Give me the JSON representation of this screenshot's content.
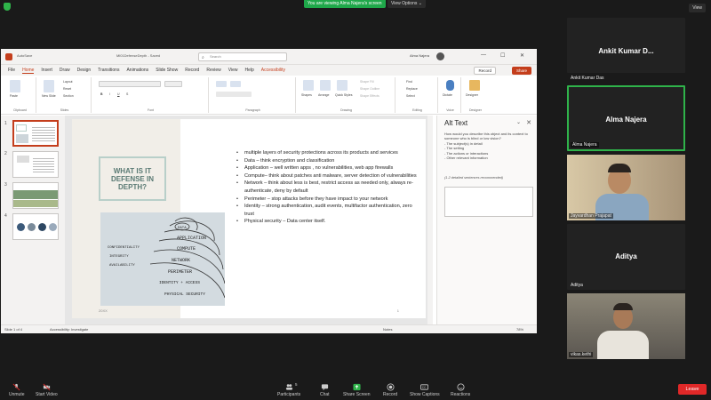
{
  "zoom": {
    "share_banner": "You are viewing Alma Najera's screen",
    "view_options": "View Options ⌄",
    "view_button": "View",
    "participants": [
      {
        "name": "Ankit Kumar D...",
        "label": "Ankit Kumar Das",
        "video": false
      },
      {
        "name": "Alma Najera",
        "label": "Alma Najera",
        "video": false,
        "active": true
      },
      {
        "label": "Jayvardhan Prajapat",
        "video": true
      },
      {
        "name": "Aditya",
        "label": "Aditya",
        "video": false
      },
      {
        "label": "vikas.kethi",
        "video": true
      }
    ],
    "toolbar": {
      "unmute": "Unmute",
      "start_video": "Start Video",
      "participants": "Participants",
      "participants_count": "5",
      "chat": "Chat",
      "share_screen": "Share Screen",
      "record": "Record",
      "show_captions": "Show Captions",
      "reactions": "Reactions",
      "leave": "Leave"
    }
  },
  "ppt": {
    "autosave": "AutoSave",
    "filename": "Ml01DefenseDepth - Saved",
    "search": "Search",
    "user": "Alma Najera",
    "menu": [
      "File",
      "Home",
      "Insert",
      "Draw",
      "Design",
      "Transitions",
      "Animations",
      "Slide Show",
      "Record",
      "Review",
      "View",
      "Help",
      "Accessibility"
    ],
    "active_tab": "Home",
    "record_btn": "Record",
    "share_btn": "Share",
    "ribbon_groups": [
      "Clipboard",
      "Slides",
      "Font",
      "Paragraph",
      "Drawing",
      "Editing",
      "Voice",
      "Designer"
    ],
    "ribbon_labels": {
      "paste": "Paste",
      "new_slide": "New Slide",
      "layout": "Layout",
      "reset": "Reset",
      "section": "Section",
      "shapes": "Shapes",
      "arrange": "Arrange",
      "quick_styles": "Quick Styles",
      "shape_fill": "Shape Fill",
      "shape_outline": "Shape Outline",
      "shape_effects": "Shape Effects",
      "find": "Find",
      "replace": "Replace",
      "select": "Select",
      "dictate": "Dictate",
      "designer": "Designer"
    },
    "thumb_numbers": [
      "1",
      "2",
      "3",
      "4"
    ],
    "slide": {
      "title": "WHAT IS IT DEFENSE IN DEPTH?",
      "bullets": [
        "multiple layers of security protections across its products and services",
        "Data – think encryption and classification",
        "Application – well written apps , no vulnerabilities, web app firewalls",
        "Compute– think about patches anti malware, server detection of vulnerabilities",
        "Network – think about less is best, restrict access as needed only, always re-authenticate, deny by default",
        "Perimeter – stop attacks before they have impact to your network",
        "Identity – strong authentication, audit events, multifactor authentication, zero trust",
        "Physical security – Data center itself."
      ],
      "footer_left": "20XX",
      "footer_right": "1",
      "photo_words": [
        "DATA",
        "APPLICATION",
        "COMPUTE",
        "NETWORK",
        "PERIMETER",
        "IDENTITY + ACCESS",
        "PHYSICAL SECURITY",
        "CONFIDENTIALITY",
        "INTEGRITY",
        "AVAILABILITY"
      ]
    },
    "alt_text": {
      "heading": "Alt Text",
      "desc": "How would you describe this object and its context to someone who is blind or low vision?",
      "items": [
        "- The subject(s) in detail",
        "- The setting",
        "- The actions or interactions",
        "- Other relevant information"
      ],
      "recommend": "(1-2 detailed sentences recommended)"
    },
    "status": {
      "slide": "Slide 1 of 4",
      "accessibility": "Accessibility: Investigate",
      "notes": "Notes",
      "zoom": "78%"
    }
  }
}
